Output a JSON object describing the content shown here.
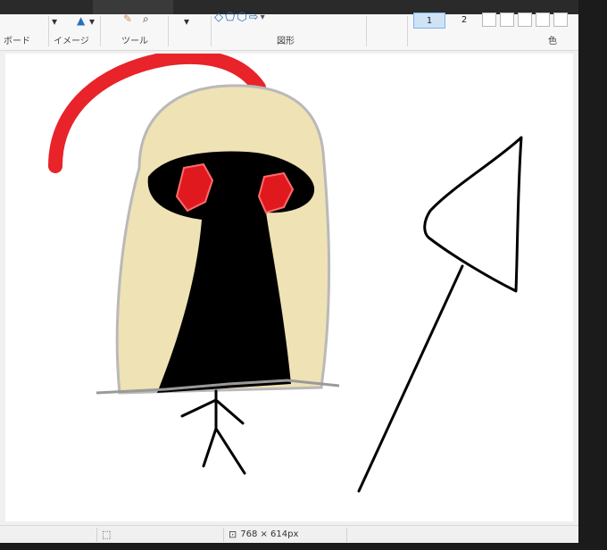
{
  "ribbon": {
    "groups": {
      "clipboard": "ボード",
      "image": "イメージ",
      "tools": "ツール",
      "shapes": "図形",
      "color": "色"
    },
    "size_options": [
      {
        "label": "1",
        "selected": true
      },
      {
        "label": "2",
        "selected": false
      }
    ]
  },
  "statusbar": {
    "canvas_size": "768 × 614px"
  },
  "colors": {
    "red_stroke": "#e8232a",
    "hair_fill": "#efe2b4",
    "hair_outline": "#b9b9b9",
    "eye_red": "#e0191e",
    "ink": "#000000"
  }
}
